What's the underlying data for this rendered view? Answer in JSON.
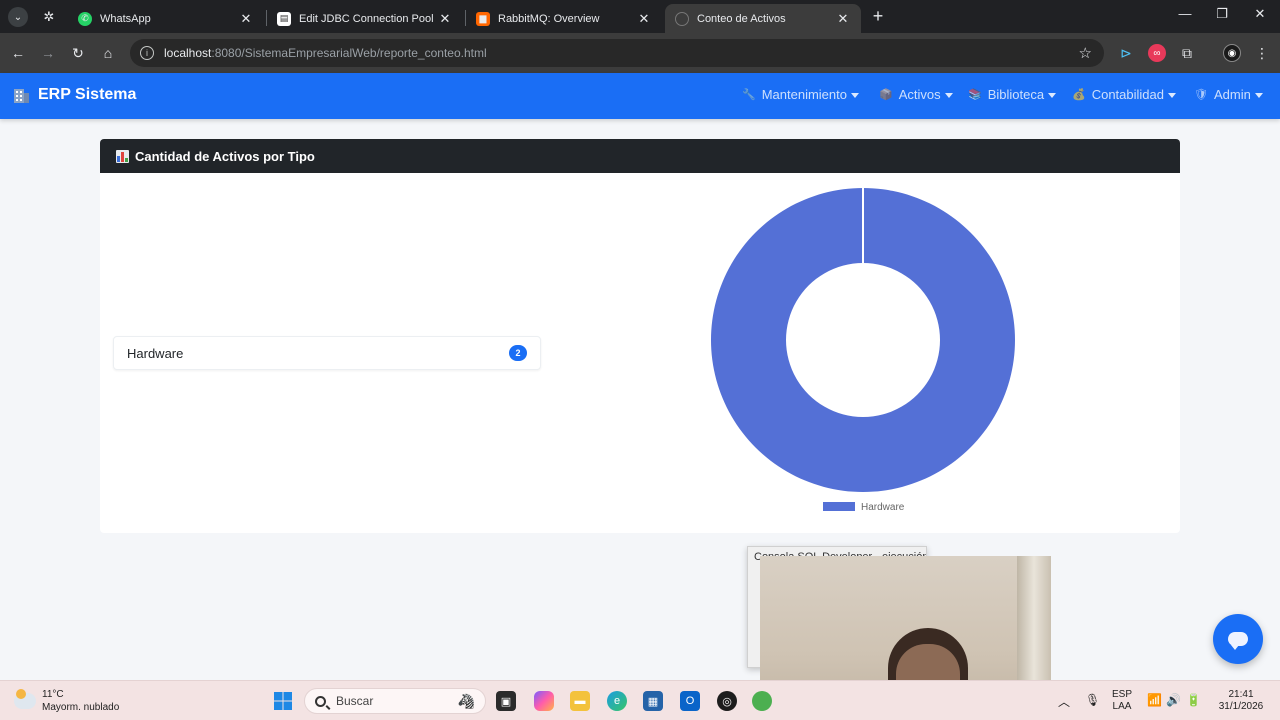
{
  "browser": {
    "tabs": [
      {
        "title": "WhatsApp",
        "close": "✕"
      },
      {
        "title": "Edit JDBC Connection Pool Properties",
        "close": "✕"
      },
      {
        "title": "RabbitMQ: Overview",
        "close": "✕"
      },
      {
        "title": "Conteo de Activos",
        "close": "✕",
        "active": true
      }
    ],
    "new_tab": "+",
    "url_host": "localhost",
    "url_path": ":8080/SistemaEmpresarialWeb/reporte_conteo.html"
  },
  "navbar": {
    "brand": "ERP Sistema",
    "items": [
      {
        "label": "Mantenimiento",
        "icon": "🔧"
      },
      {
        "label": "Activos",
        "icon": "📦"
      },
      {
        "label": "Biblioteca",
        "icon": "📚"
      },
      {
        "label": "Contabilidad",
        "icon": "💰"
      },
      {
        "label": "Admin",
        "icon": "🛡"
      }
    ]
  },
  "card": {
    "title": "Cantidad de Activos por Tipo",
    "list": [
      {
        "label": "Hardware",
        "count": "2"
      }
    ]
  },
  "chart_data": {
    "type": "pie",
    "variant": "doughnut",
    "categories": [
      "Hardware"
    ],
    "values": [
      2
    ],
    "legend": "bottom",
    "colors": [
      "#5470d6"
    ]
  },
  "floating_window": {
    "title": "Consola SQL Developer - ejecución"
  },
  "taskbar": {
    "temperature": "11°C",
    "condition": "Mayorm. nublado",
    "search": "Buscar",
    "lang_top": "ESP",
    "lang_bottom": "LAA",
    "time": "21:41",
    "date": "31/1/2026"
  },
  "colors": {
    "navbar": "#1a6ef5",
    "card_header": "#212529",
    "badge": "#1a6ef5",
    "chart_slice": "#5470d6"
  }
}
